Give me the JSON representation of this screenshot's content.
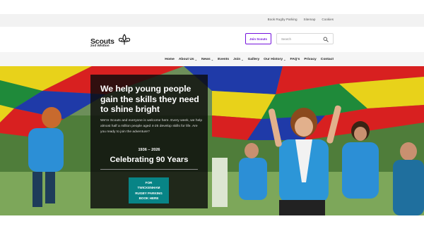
{
  "utility_links": [
    "Book Rugby Parking",
    "Sitemap",
    "Cookies"
  ],
  "logo": {
    "word": "Scouts",
    "group": "2nd Whitton"
  },
  "header": {
    "join_label": "Join Scouts",
    "search_placeholder": "Search"
  },
  "nav": [
    {
      "label": "Home",
      "has_caret": false
    },
    {
      "label": "About Us",
      "has_caret": true
    },
    {
      "label": "News",
      "has_caret": true
    },
    {
      "label": "Events",
      "has_caret": false
    },
    {
      "label": "Join",
      "has_caret": true
    },
    {
      "label": "Gallery",
      "has_caret": false
    },
    {
      "label": "Our History",
      "has_caret": true
    },
    {
      "label": "FAQ's",
      "has_caret": false
    },
    {
      "label": "Privacy",
      "has_caret": false
    },
    {
      "label": "Contact",
      "has_caret": false
    }
  ],
  "hero": {
    "title": "We help young people gain the skills they need to shine bright",
    "body": "We're Scouts and everyone is welcome here. Every week, we help almost half a million people aged 4-25 develop skills for life. Are you ready to join the adventure?",
    "years": "1936 – 2026",
    "celebrating": "Celebrating 90 Years",
    "cta_lines": [
      "FOR",
      "TWICKENHAM",
      "RUGBY PARKING",
      "BOOK HERE"
    ]
  },
  "colors": {
    "brand_purple": "#7413dc",
    "teal": "#088486",
    "panel": "#0c0c0c"
  },
  "icons": {
    "logo_mark": "fleur-de-lis-icon",
    "search": "search-icon",
    "caret": "chevron-down-icon"
  }
}
